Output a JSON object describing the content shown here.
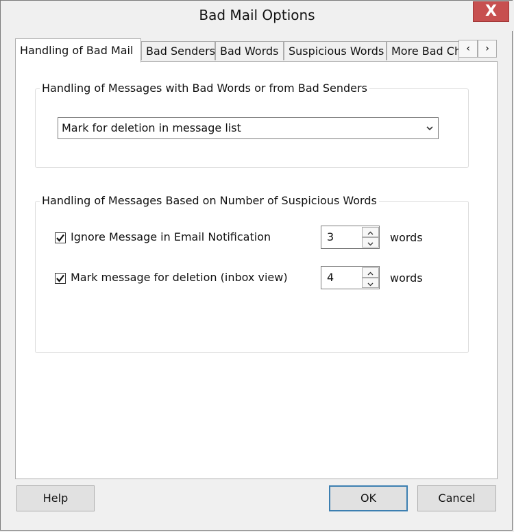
{
  "window": {
    "title": "Bad Mail Options",
    "close_label": "X"
  },
  "tabs": [
    {
      "label": "Handling of Bad Mail",
      "active": true
    },
    {
      "label": "Bad Senders",
      "active": false
    },
    {
      "label": "Bad Words",
      "active": false
    },
    {
      "label": "Suspicious Words",
      "active": false
    },
    {
      "label": "More Bad Ch",
      "active": false
    }
  ],
  "tab_scroll": {
    "left_icon": "chevron-left-icon",
    "right_icon": "chevron-right-icon",
    "left_glyph": "‹",
    "right_glyph": "›"
  },
  "group1": {
    "legend": "Handling of Messages with Bad Words or from Bad Senders",
    "dropdown_value": "Mark for deletion in message list"
  },
  "group2": {
    "legend": "Handling of Messages Based on Number of Suspicious Words",
    "rows": [
      {
        "label": "Ignore Message in Email Notification",
        "checked": true,
        "value": "3",
        "unit": "words"
      },
      {
        "label": "Mark message for deletion (inbox view)",
        "checked": true,
        "value": "4",
        "unit": "words"
      }
    ]
  },
  "buttons": {
    "help": "Help",
    "ok": "OK",
    "cancel": "Cancel"
  },
  "colors": {
    "close_button": "#c75050",
    "default_button_border": "#3c7fb1"
  }
}
